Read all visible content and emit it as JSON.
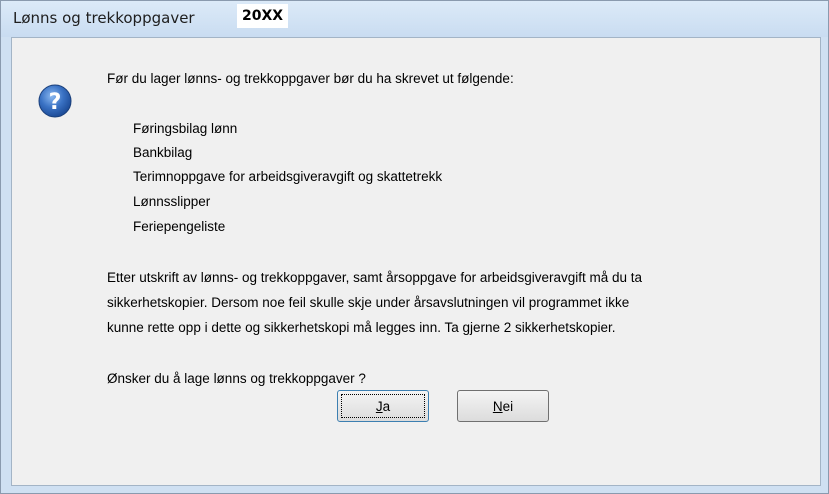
{
  "window": {
    "title": "Lønns og trekkoppgaver",
    "title_year": "20XX"
  },
  "icon": "question-mark-icon",
  "message": {
    "intro": "Før du lager lønns- og trekkoppgaver bør du ha skrevet ut følgende:",
    "items": [
      "Føringsbilag lønn",
      "Bankbilag",
      "Terimnoppgave for arbeidsgiveravgift og skattetrekk",
      "Lønnsslipper",
      "Feriepengeliste"
    ],
    "paragraph_lines": [
      "Etter utskrift av lønns- og trekkoppgaver, samt årsoppgave for arbeidsgiveravgift må du ta",
      "sikkerhetskopier. Dersom noe feil skulle skje under årsavslutningen vil programmet ikke",
      "kunne rette opp i dette og sikkerhetskopi må legges inn. Ta gjerne 2 sikkerhetskopier."
    ],
    "question": "Ønsker du å lage lønns og trekkoppgaver ?"
  },
  "buttons": {
    "yes": {
      "accel": "J",
      "rest": "a"
    },
    "no": {
      "accel": "N",
      "rest": "ei"
    }
  },
  "colors": {
    "titlebar": "#cfe0f2",
    "client": "#f0f0f0",
    "icon_blue": "#2a5fb0"
  }
}
